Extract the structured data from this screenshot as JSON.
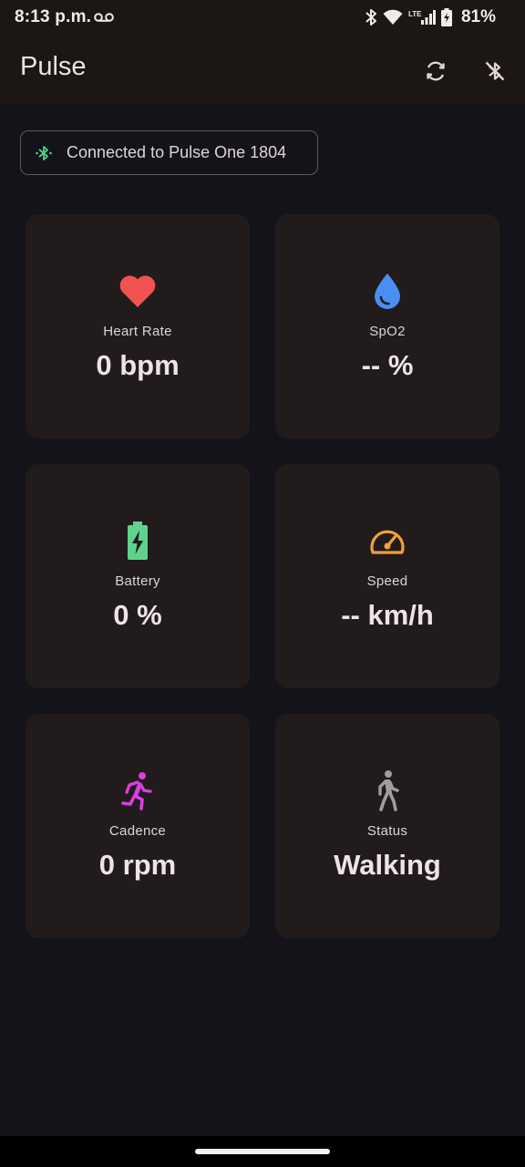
{
  "status_bar": {
    "time": "8:13 p.m.",
    "battery_percent": "81%",
    "icons": [
      "voicemail-icon",
      "bluetooth-icon",
      "wifi-icon",
      "lte-signal-icon",
      "battery-charging-icon"
    ]
  },
  "app_bar": {
    "title": "Pulse",
    "actions": [
      "refresh-icon",
      "bluetooth-disabled-icon"
    ]
  },
  "connection": {
    "icon": "bluetooth-connected-icon",
    "text": "Connected to Pulse One 1804",
    "color": "#4fd08a"
  },
  "metrics": [
    {
      "label": "Heart Rate",
      "value": "0 bpm",
      "icon": "heart-icon",
      "color": "#f0524f"
    },
    {
      "label": "SpO2",
      "value": "-- %",
      "icon": "water-drop-icon",
      "color": "#4a8ff0"
    },
    {
      "label": "Battery",
      "value": "0 %",
      "icon": "battery-charging-icon",
      "color": "#5fd38e"
    },
    {
      "label": "Speed",
      "value": "-- km/h",
      "icon": "speedometer-icon",
      "color": "#f0a236"
    },
    {
      "label": "Cadence",
      "value": "0 rpm",
      "icon": "running-icon",
      "color": "#d93fe0"
    },
    {
      "label": "Status",
      "value": "Walking",
      "icon": "walking-icon",
      "color": "#9e9e9e"
    }
  ],
  "colors": {
    "background": "#15131a",
    "app_bar": "#1c1615",
    "card": "#211b1b",
    "text": "#ece4e6"
  }
}
